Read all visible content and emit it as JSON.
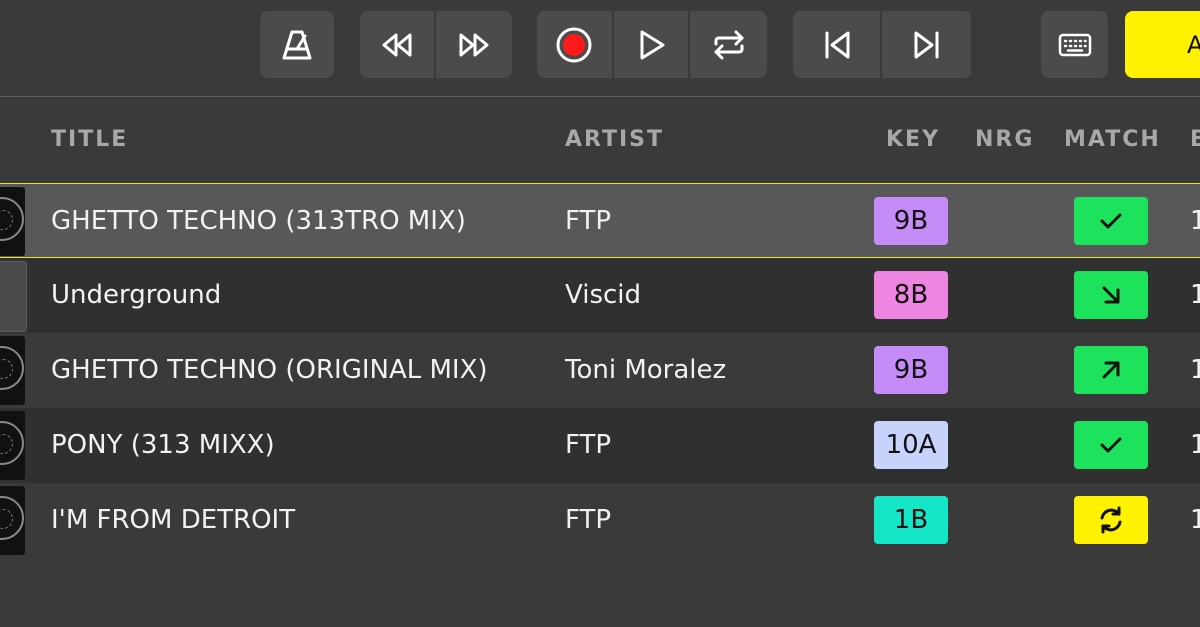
{
  "toolbar": {
    "buttons": [
      {
        "name": "metronome-button",
        "icon": "metronome-icon"
      },
      {
        "name": "rewind-button",
        "icon": "rewind-icon"
      },
      {
        "name": "fast-forward-button",
        "icon": "fast-forward-icon"
      },
      {
        "name": "record-button",
        "icon": "record-icon"
      },
      {
        "name": "play-button",
        "icon": "play-icon"
      },
      {
        "name": "loop-button",
        "icon": "repeat-icon"
      },
      {
        "name": "previous-track-button",
        "icon": "skip-back-icon"
      },
      {
        "name": "next-track-button",
        "icon": "skip-forward-icon"
      },
      {
        "name": "keyboard-button",
        "icon": "keyboard-icon"
      }
    ],
    "auto_label": "A",
    "colors": {
      "record": "#ff1a1a",
      "auto_bg": "#fff200"
    }
  },
  "table": {
    "headers": {
      "title": "TITLE",
      "artist": "ARTIST",
      "key": "KEY",
      "nrg": "NRG",
      "match": "MATCH",
      "extra": "B"
    },
    "rows": [
      {
        "title": "GHETTO TECHNO (313TRO MIX)",
        "artist": "FTP",
        "key": "9B",
        "key_color": "#c58cf7",
        "match": "check-icon",
        "match_color": "#1de35c",
        "extra": "1",
        "selected": true
      },
      {
        "title": "Underground",
        "artist": "Viscid",
        "key": "8B",
        "key_color": "#ee85e0",
        "match": "arrow-down-right-icon",
        "match_color": "#1de35c",
        "extra": "1"
      },
      {
        "title": "GHETTO TECHNO (ORIGINAL MIX)",
        "artist": "Toni Moralez",
        "key": "9B",
        "key_color": "#c58cf7",
        "match": "arrow-up-right-icon",
        "match_color": "#1de35c",
        "extra": "1"
      },
      {
        "title": "PONY (313 MIXX)",
        "artist": "FTP",
        "key": "10A",
        "key_color": "#c7d3fb",
        "match": "check-icon",
        "match_color": "#1de35c",
        "extra": "1"
      },
      {
        "title": "I'M FROM DETROIT",
        "artist": "FTP",
        "key": "1B",
        "key_color": "#16e6c8",
        "match": "refresh-icon",
        "match_color": "#fff200",
        "extra": "1"
      }
    ]
  },
  "colors": {
    "selection_border": "#e8e33a",
    "background": "#3a3a3a"
  }
}
